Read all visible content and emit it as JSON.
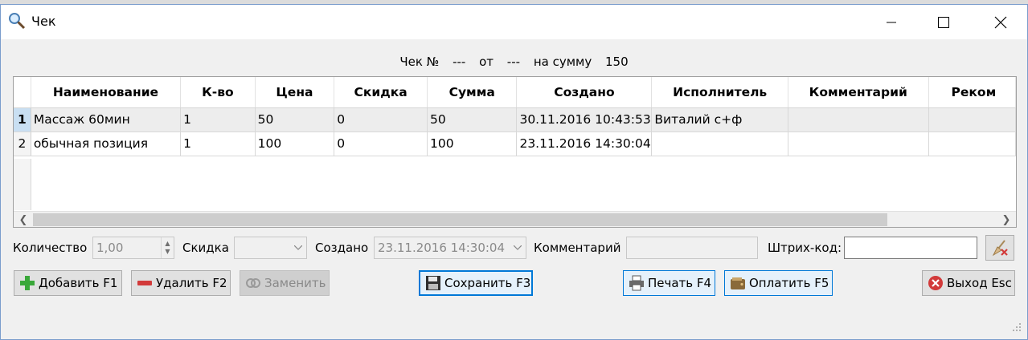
{
  "window": {
    "title": "Чек"
  },
  "header": {
    "check_label": "Чек №",
    "check_no": "---",
    "from_label": "от",
    "from_value": "---",
    "sum_label": "на сумму",
    "sum_value": "150"
  },
  "grid": {
    "columns": [
      "Наименование",
      "К-во",
      "Цена",
      "Скидка",
      "Сумма",
      "Создано",
      "Исполнитель",
      "Комментарий",
      "Реком"
    ],
    "rows": [
      {
        "num": "1",
        "cells": [
          "Массаж 60мин",
          "1",
          "50",
          "0",
          "50",
          "30.11.2016 10:43:53",
          "Виталий с+ф",
          "",
          ""
        ]
      },
      {
        "num": "2",
        "cells": [
          "обычная позиция",
          "1",
          "100",
          "0",
          "100",
          "23.11.2016 14:30:04",
          "",
          "",
          ""
        ]
      }
    ]
  },
  "fields": {
    "qty_label": "Количество",
    "qty_value": "1,00",
    "discount_label": "Скидка",
    "discount_value": "",
    "created_label": "Создано",
    "created_value": "23.11.2016 14:30:04",
    "comment_label": "Комментарий",
    "comment_value": "",
    "barcode_label": "Штрих-код:",
    "barcode_value": ""
  },
  "buttons": {
    "add": "Добавить F1",
    "delete": "Удалить F2",
    "replace": "Заменить",
    "save": "Сохранить F3",
    "print": "Печать F4",
    "pay": "Оплатить F5",
    "exit": "Выход Esc"
  },
  "colors": {
    "accent": "#0078d7",
    "selected_row": "#ededed",
    "row_header_selected": "#c9dff2"
  }
}
